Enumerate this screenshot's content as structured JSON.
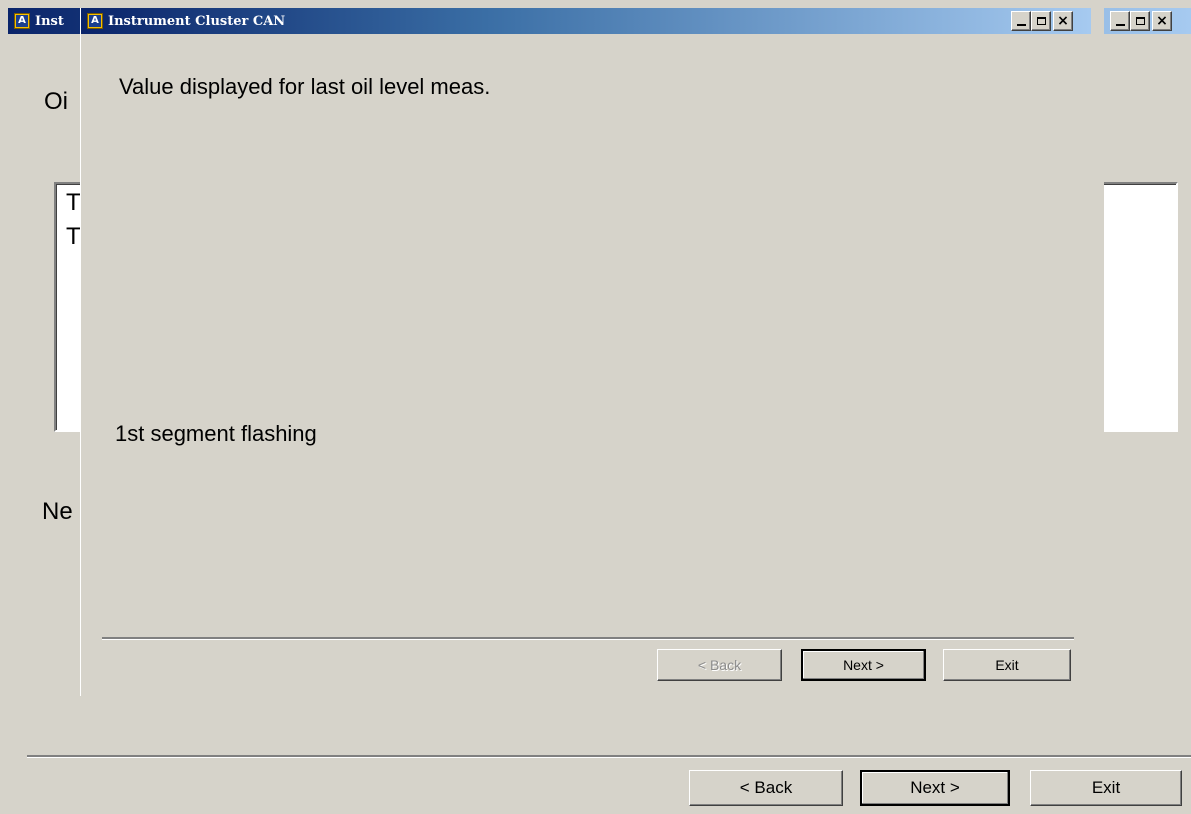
{
  "background_window": {
    "title": "Inst",
    "icon": "app-logo-icon",
    "heading_partial": "Oi",
    "list_items": [
      "T",
      "T"
    ],
    "next_label_partial": "Ne",
    "buttons": {
      "back": "< Back",
      "next": "Next >",
      "exit": "Exit"
    },
    "controls": {
      "minimize": "_",
      "maximize": "□",
      "close": "×"
    }
  },
  "dialog": {
    "title": "Instrument Cluster CAN",
    "icon": "app-logo-icon",
    "prompt": "Value displayed for last oil level meas.",
    "answer": "1st segment flashing",
    "buttons": {
      "back": "< Back",
      "next": "Next >",
      "exit": "Exit"
    },
    "back_enabled": false,
    "controls": {
      "minimize": "_",
      "maximize": "□",
      "close": "×"
    }
  },
  "colors": {
    "title_gradient_start": "#0a246a",
    "title_gradient_end": "#a6caf0",
    "face": "#d6d3ca",
    "icon_yellow": "#f5c000"
  }
}
